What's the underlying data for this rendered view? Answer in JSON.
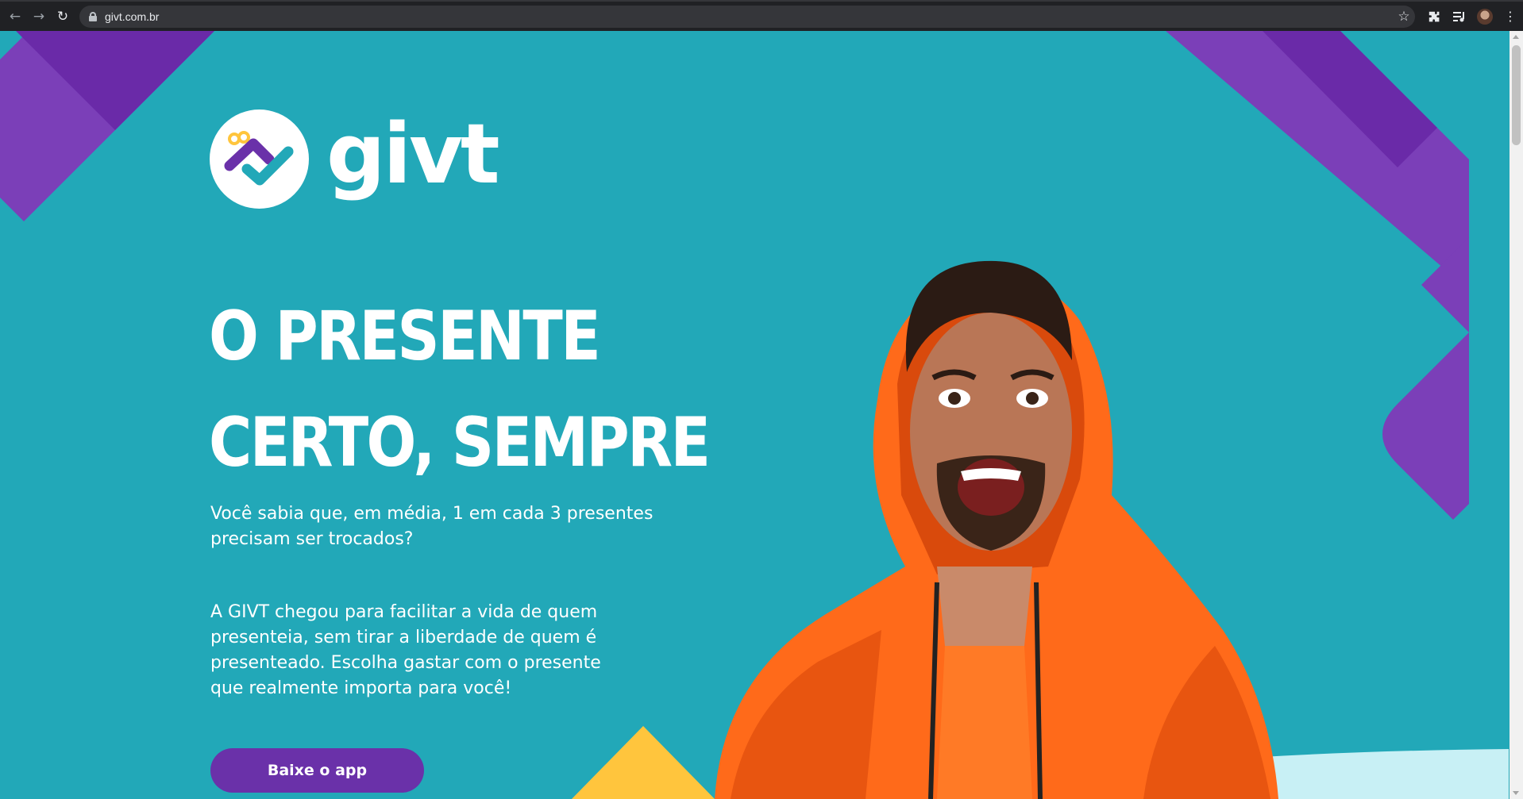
{
  "browser": {
    "url": "givt.com.br",
    "back_icon": "arrow-left-icon",
    "forward_icon": "arrow-right-icon",
    "reload_icon": "reload-icon",
    "lock_icon": "lock-icon",
    "bookmark_icon": "star-icon",
    "extensions_icon": "puzzle-icon",
    "media_icon": "playlist-icon",
    "profile_icon": "avatar-icon",
    "menu_icon": "kebab-menu-icon"
  },
  "brand": {
    "name": "givt",
    "colors": {
      "background": "#22a8b8",
      "purple": "#6a31a9",
      "purple_light": "#7b3fb8",
      "yellow": "#ffc53d",
      "orange": "#ff6a1a",
      "mint": "#c8f0f5"
    }
  },
  "hero": {
    "title_line1": "O PRESENTE",
    "title_line2": "CERTO, SEMPRE",
    "paragraph1": "Você sabia que, em média, 1 em cada 3 presentes precisam ser trocados?",
    "paragraph2": "A GIVT chegou para facilitar a vida de quem presenteia, sem tirar a liberdade de quem é presenteado. Escolha gastar com o presente que realmente importa para você!",
    "cta_label": "Baixe o app"
  }
}
